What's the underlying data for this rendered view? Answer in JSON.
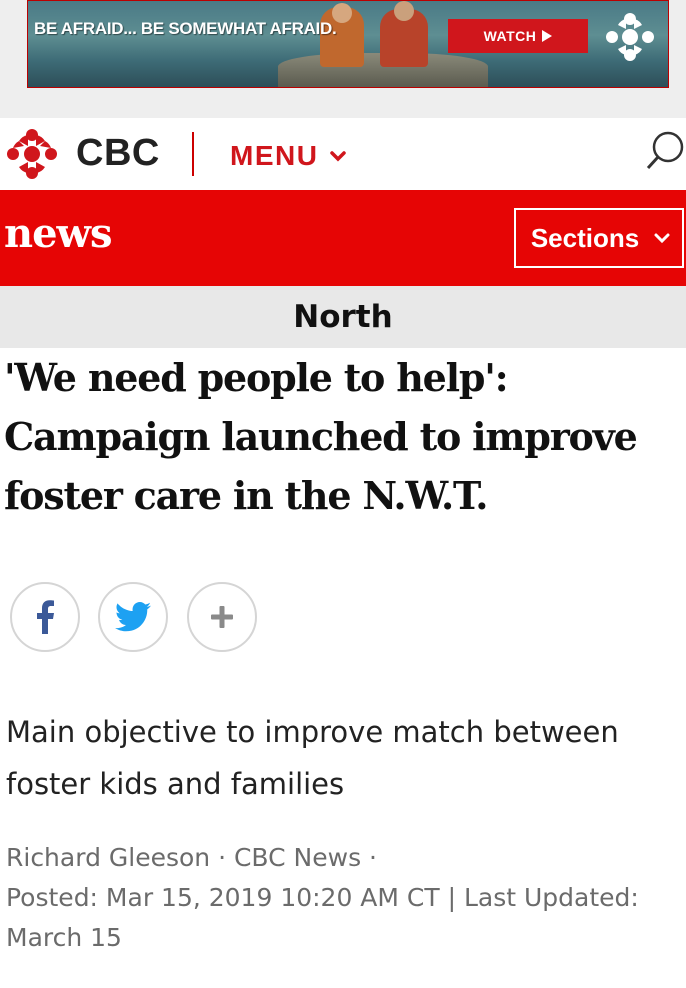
{
  "ad": {
    "tagline": "BE AFRAID... BE SOMEWHAT AFRAID.",
    "watch_label": "WATCH",
    "brand_color": "#d0161c"
  },
  "header": {
    "brand": "CBC",
    "menu_label": "MENU",
    "accent": "#d0161c"
  },
  "news_bar": {
    "title": "news",
    "sections_label": "Sections",
    "bg": "#e60505"
  },
  "article": {
    "section": "North",
    "headline_lines": [
      "'We need people to help':",
      "Campaign launched to improve",
      "foster care in the N.W.T."
    ],
    "share": [
      "facebook-icon",
      "twitter-icon",
      "plus-icon"
    ],
    "deck_lines": [
      "Main objective to improve match between",
      "foster kids and families"
    ],
    "byline_lines": [
      "Richard Gleeson · CBC News ·",
      "Posted: Mar 15, 2019 10:20 AM CT | Last Updated:",
      "March 15"
    ]
  }
}
